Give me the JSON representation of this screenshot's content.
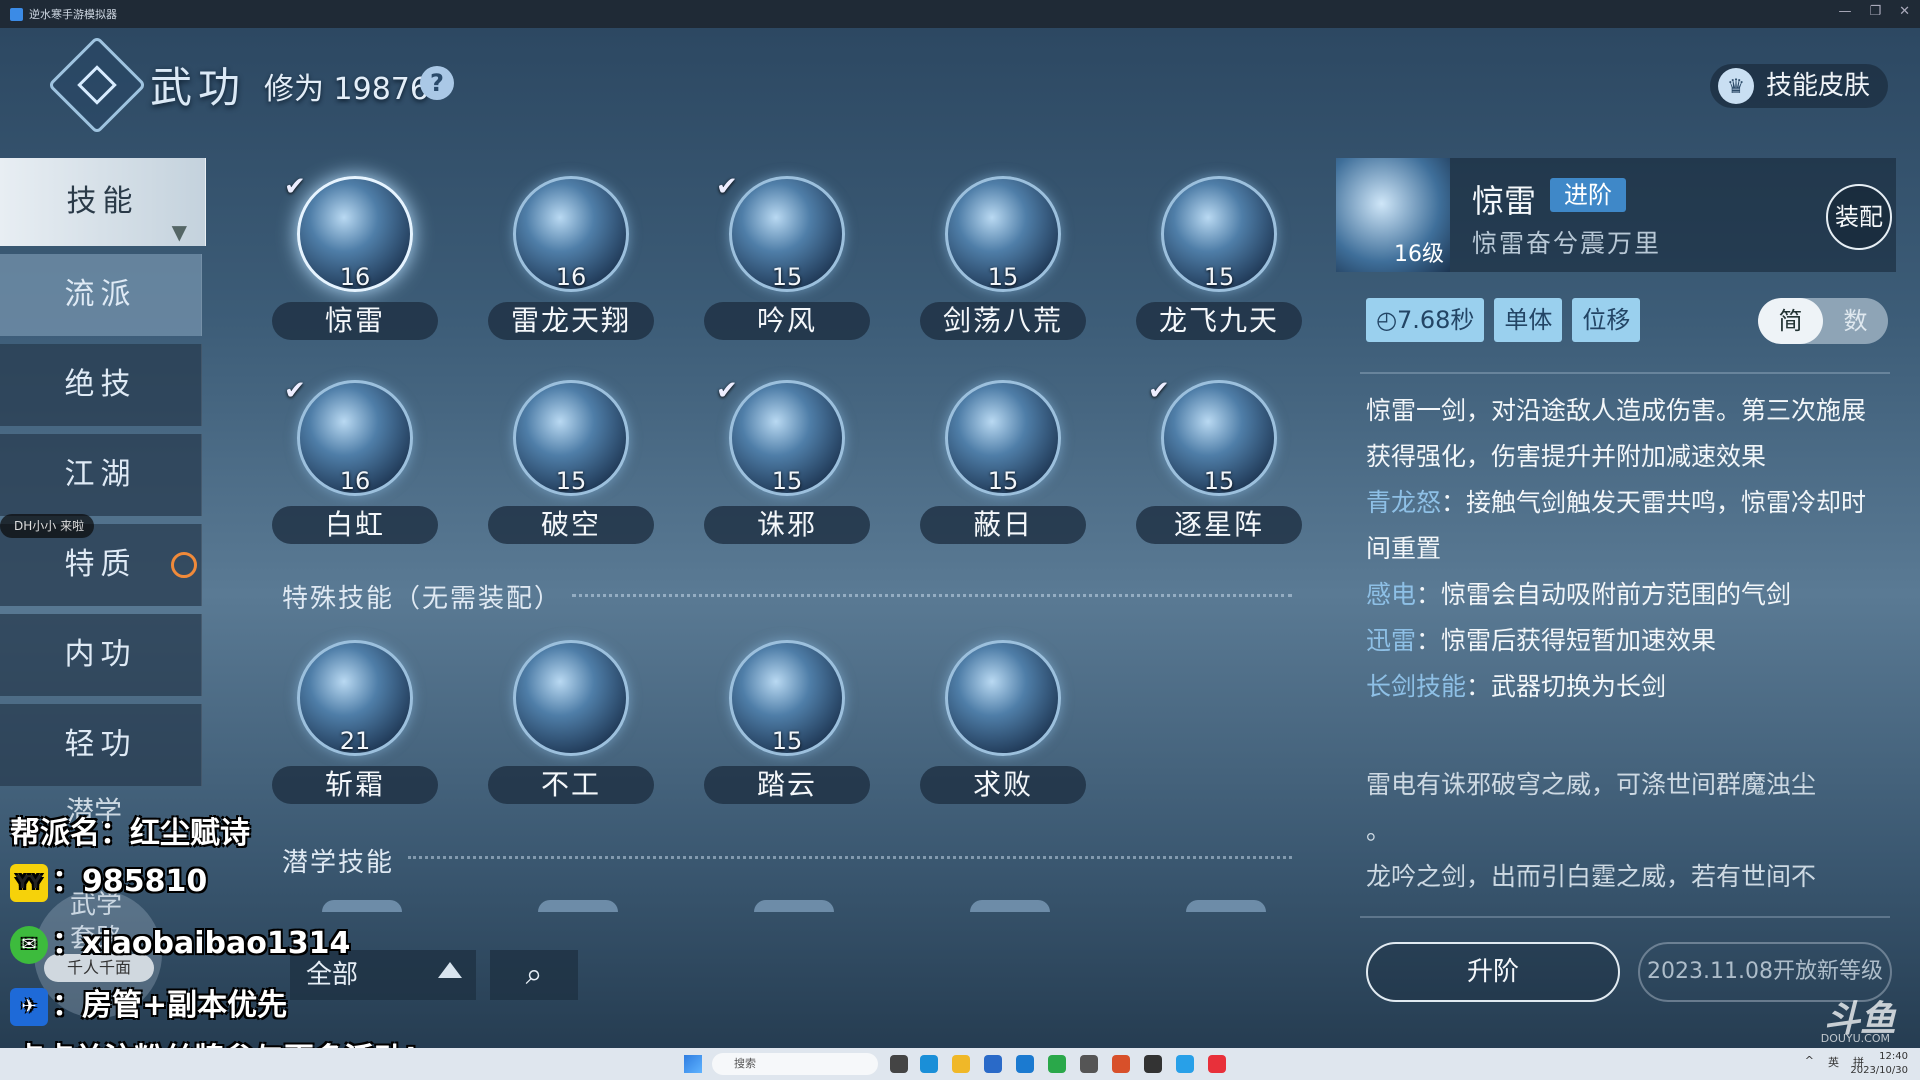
{
  "window": {
    "title": "逆水寒手游模拟器",
    "controls": [
      "—",
      "❐",
      "✕"
    ]
  },
  "header": {
    "title": "武功",
    "cultivation": "修为 19876",
    "help": "?",
    "skin_button": "技能皮肤"
  },
  "sidebar": [
    {
      "label": "技能",
      "active": true
    },
    {
      "label": "流派"
    },
    {
      "label": "绝技"
    },
    {
      "label": "江湖"
    },
    {
      "label": "特质"
    },
    {
      "label": "内功"
    },
    {
      "label": "轻功"
    }
  ],
  "sidebar_faded": [
    "潜学",
    "武学",
    "套路"
  ],
  "skills": [
    {
      "name": "惊雷",
      "level": "16",
      "equipped": true,
      "selected": true
    },
    {
      "name": "雷龙天翔",
      "level": "16",
      "equipped": false
    },
    {
      "name": "吟风",
      "level": "15",
      "equipped": true
    },
    {
      "name": "剑荡八荒",
      "level": "15",
      "equipped": false
    },
    {
      "name": "龙飞九天",
      "level": "15",
      "equipped": false
    },
    {
      "name": "白虹",
      "level": "16",
      "equipped": true
    },
    {
      "name": "破空",
      "level": "15",
      "equipped": false
    },
    {
      "name": "诛邪",
      "level": "15",
      "equipped": true
    },
    {
      "name": "蔽日",
      "level": "15",
      "equipped": false
    },
    {
      "name": "逐星阵",
      "level": "15",
      "equipped": true
    }
  ],
  "special_section": "特殊技能（无需装配）",
  "special_skills": [
    {
      "name": "斩霜",
      "level": "21"
    },
    {
      "name": "不工",
      "level": ""
    },
    {
      "name": "踏云",
      "level": "15"
    },
    {
      "name": "求败",
      "level": ""
    }
  ],
  "latent_section": "潜学技能",
  "filter": {
    "label": "全部"
  },
  "detail": {
    "name": "惊雷",
    "advance": "进阶",
    "subtitle": "惊雷奋兮震万里",
    "level": "16级",
    "equip": "装配",
    "cooldown": "7.68秒",
    "tags": [
      "单体",
      "位移"
    ],
    "toggle": [
      "简",
      "数"
    ],
    "desc_main": "惊雷一剑，对沿途敌人造成伤害。第三次施展获得强化，伤害提升并附加减速效果",
    "effects": [
      {
        "key": "青龙怒",
        "text": "：接触气剑触发天雷共鸣，惊雷冷却时间重置"
      },
      {
        "key": "感电",
        "text": "：惊雷会自动吸附前方范围的气剑"
      },
      {
        "key": "迅雷",
        "text": "：惊雷后获得短暂加速效果"
      },
      {
        "key": "长剑技能",
        "text": "：武器切换为长剑"
      }
    ],
    "lore": [
      "雷电有诛邪破穹之威，可涤世间群魔浊尘",
      "。",
      "龙吟之剑，出而引白霆之威，若有世间不"
    ],
    "upgrade": "升阶",
    "notice": "2023.11.08开放新等级"
  },
  "watermark": {
    "brand": "斗鱼",
    "url": "DOUYU.COM"
  },
  "stream_overlay": {
    "guild": "帮派名：红尘赋诗",
    "yy": "：985810",
    "wechat": "：xiaobaibao1314",
    "qq": "：房管+副本优先",
    "cta": "点点关注粉丝牌参与更多活动!",
    "live_tag": "DH小小  来啦",
    "avatar_label": "千人千面"
  },
  "taskbar": {
    "search": "搜索",
    "tray": [
      "^",
      "英",
      "拼"
    ],
    "time": "12:40",
    "date": "2023/10/30"
  }
}
